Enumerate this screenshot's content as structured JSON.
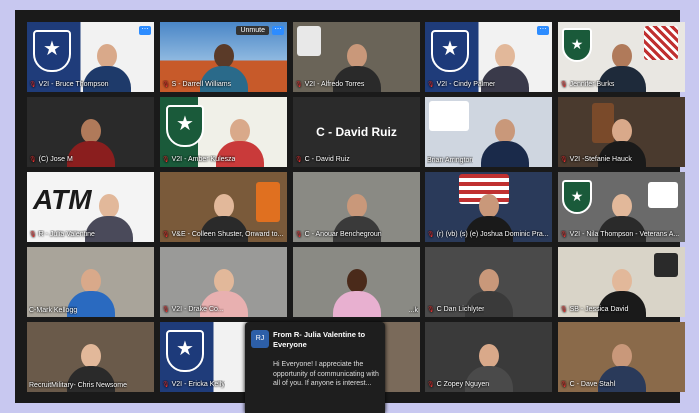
{
  "participants": [
    {
      "name": "V2I - Bruce Thompson",
      "active": true
    },
    {
      "name": "S - Darrell Williams",
      "unmute": "Unmute"
    },
    {
      "name": "V2I - Alfredo Torres"
    },
    {
      "name": "V2I - Cindy Palmer"
    },
    {
      "name": "Jennifer Burks"
    },
    {
      "name": "(C) Jose M"
    },
    {
      "name": "V2I - Amber Kulesza"
    },
    {
      "name": "C - David Ruiz",
      "big": "C - David Ruiz"
    },
    {
      "name": "Brian Arrington"
    },
    {
      "name": "V2I -Stefanie Hauck"
    },
    {
      "name": "R - Julia Valentine",
      "atm": "ATM"
    },
    {
      "name": "V&E - Colleen Shuster, Onward to..."
    },
    {
      "name": "C - Anouar Benchegroun"
    },
    {
      "name": "(r) (vb) (s) (e) Joshua Dominic Pra..."
    },
    {
      "name": "V2I - Nila Thompson - Veterans A..."
    },
    {
      "name": "C-Mark Kellogg"
    },
    {
      "name": "V2I - Drake Co..."
    },
    {
      "name": "...k"
    },
    {
      "name": "C Dan Lichlyter"
    },
    {
      "name": "SB - Jessica David"
    },
    {
      "name": "RecruitMilitary- Chris Newsome"
    },
    {
      "name": "V2I - Ericka Kelly"
    },
    {
      "name": ""
    },
    {
      "name": "C Zopey Nguyen"
    },
    {
      "name": "C - Dave Stahl"
    }
  ],
  "chat": {
    "avatar": "RJ",
    "from": "From R- Julia Valentine to Everyone",
    "message": "Hi Everyone! I appreciate the opportunity of communicating with all of you. If anyone is interest..."
  },
  "colors": {
    "accent": "#2d8cff",
    "active_border": "#d9d94a",
    "muted_mic": "#e03030"
  }
}
